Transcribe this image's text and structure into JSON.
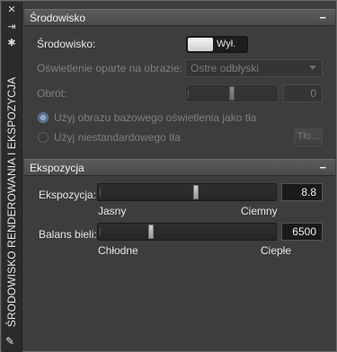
{
  "panel": {
    "vertical_title": "ŚRODOWISKO RENDEROWANIA I EKSPOZYCJA",
    "titlebar_icons": [
      "close-icon",
      "auto-hide-icon",
      "properties-icon"
    ],
    "grip_icon": "pin-icon"
  },
  "environment": {
    "header": "Środowisko",
    "collapse": "−",
    "toggle_label": "Środowisko:",
    "toggle_state": "Wył.",
    "ibl_label": "Oświetlenie oparte na obrazie:",
    "ibl_value": "Ostre odbłyski",
    "rotation_label": "Obrót:",
    "rotation_value": "0",
    "rotation_fraction": 0.5,
    "radio_ibl_bg": "Użyj obrazu bazowego oświetlenia jako tła",
    "radio_custom_bg": "Użyj niestandardowego tła",
    "bg_button": "Tło..."
  },
  "exposure": {
    "header": "Ekspozycja",
    "collapse": "−",
    "exposure_label": "Ekspozycja:",
    "exposure_value": "8.8",
    "exposure_fraction": 0.55,
    "exposure_min": "Jasny",
    "exposure_max": "Ciemny",
    "wb_label": "Balans bieli:",
    "wb_value": "6500",
    "wb_fraction": 0.3,
    "wb_min": "Chłodne",
    "wb_max": "Ciepłe"
  },
  "colors": {
    "background": "#3d3d3d",
    "header": "#4f4f4f",
    "disabled_text": "#7f7f7f",
    "radio_accent": "#8ea6c6"
  }
}
